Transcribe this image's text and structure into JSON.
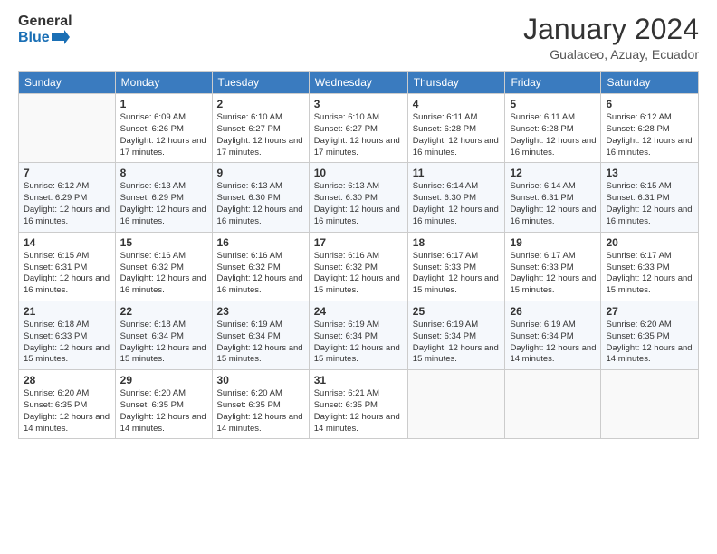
{
  "header": {
    "logo_general": "General",
    "logo_blue": "Blue",
    "month_title": "January 2024",
    "subtitle": "Gualaceo, Azuay, Ecuador"
  },
  "weekdays": [
    "Sunday",
    "Monday",
    "Tuesday",
    "Wednesday",
    "Thursday",
    "Friday",
    "Saturday"
  ],
  "weeks": [
    [
      {
        "day": "",
        "sunrise": "",
        "sunset": "",
        "daylight": ""
      },
      {
        "day": "1",
        "sunrise": "Sunrise: 6:09 AM",
        "sunset": "Sunset: 6:26 PM",
        "daylight": "Daylight: 12 hours and 17 minutes."
      },
      {
        "day": "2",
        "sunrise": "Sunrise: 6:10 AM",
        "sunset": "Sunset: 6:27 PM",
        "daylight": "Daylight: 12 hours and 17 minutes."
      },
      {
        "day": "3",
        "sunrise": "Sunrise: 6:10 AM",
        "sunset": "Sunset: 6:27 PM",
        "daylight": "Daylight: 12 hours and 17 minutes."
      },
      {
        "day": "4",
        "sunrise": "Sunrise: 6:11 AM",
        "sunset": "Sunset: 6:28 PM",
        "daylight": "Daylight: 12 hours and 16 minutes."
      },
      {
        "day": "5",
        "sunrise": "Sunrise: 6:11 AM",
        "sunset": "Sunset: 6:28 PM",
        "daylight": "Daylight: 12 hours and 16 minutes."
      },
      {
        "day": "6",
        "sunrise": "Sunrise: 6:12 AM",
        "sunset": "Sunset: 6:28 PM",
        "daylight": "Daylight: 12 hours and 16 minutes."
      }
    ],
    [
      {
        "day": "7",
        "sunrise": "Sunrise: 6:12 AM",
        "sunset": "Sunset: 6:29 PM",
        "daylight": "Daylight: 12 hours and 16 minutes."
      },
      {
        "day": "8",
        "sunrise": "Sunrise: 6:13 AM",
        "sunset": "Sunset: 6:29 PM",
        "daylight": "Daylight: 12 hours and 16 minutes."
      },
      {
        "day": "9",
        "sunrise": "Sunrise: 6:13 AM",
        "sunset": "Sunset: 6:30 PM",
        "daylight": "Daylight: 12 hours and 16 minutes."
      },
      {
        "day": "10",
        "sunrise": "Sunrise: 6:13 AM",
        "sunset": "Sunset: 6:30 PM",
        "daylight": "Daylight: 12 hours and 16 minutes."
      },
      {
        "day": "11",
        "sunrise": "Sunrise: 6:14 AM",
        "sunset": "Sunset: 6:30 PM",
        "daylight": "Daylight: 12 hours and 16 minutes."
      },
      {
        "day": "12",
        "sunrise": "Sunrise: 6:14 AM",
        "sunset": "Sunset: 6:31 PM",
        "daylight": "Daylight: 12 hours and 16 minutes."
      },
      {
        "day": "13",
        "sunrise": "Sunrise: 6:15 AM",
        "sunset": "Sunset: 6:31 PM",
        "daylight": "Daylight: 12 hours and 16 minutes."
      }
    ],
    [
      {
        "day": "14",
        "sunrise": "Sunrise: 6:15 AM",
        "sunset": "Sunset: 6:31 PM",
        "daylight": "Daylight: 12 hours and 16 minutes."
      },
      {
        "day": "15",
        "sunrise": "Sunrise: 6:16 AM",
        "sunset": "Sunset: 6:32 PM",
        "daylight": "Daylight: 12 hours and 16 minutes."
      },
      {
        "day": "16",
        "sunrise": "Sunrise: 6:16 AM",
        "sunset": "Sunset: 6:32 PM",
        "daylight": "Daylight: 12 hours and 16 minutes."
      },
      {
        "day": "17",
        "sunrise": "Sunrise: 6:16 AM",
        "sunset": "Sunset: 6:32 PM",
        "daylight": "Daylight: 12 hours and 15 minutes."
      },
      {
        "day": "18",
        "sunrise": "Sunrise: 6:17 AM",
        "sunset": "Sunset: 6:33 PM",
        "daylight": "Daylight: 12 hours and 15 minutes."
      },
      {
        "day": "19",
        "sunrise": "Sunrise: 6:17 AM",
        "sunset": "Sunset: 6:33 PM",
        "daylight": "Daylight: 12 hours and 15 minutes."
      },
      {
        "day": "20",
        "sunrise": "Sunrise: 6:17 AM",
        "sunset": "Sunset: 6:33 PM",
        "daylight": "Daylight: 12 hours and 15 minutes."
      }
    ],
    [
      {
        "day": "21",
        "sunrise": "Sunrise: 6:18 AM",
        "sunset": "Sunset: 6:33 PM",
        "daylight": "Daylight: 12 hours and 15 minutes."
      },
      {
        "day": "22",
        "sunrise": "Sunrise: 6:18 AM",
        "sunset": "Sunset: 6:34 PM",
        "daylight": "Daylight: 12 hours and 15 minutes."
      },
      {
        "day": "23",
        "sunrise": "Sunrise: 6:19 AM",
        "sunset": "Sunset: 6:34 PM",
        "daylight": "Daylight: 12 hours and 15 minutes."
      },
      {
        "day": "24",
        "sunrise": "Sunrise: 6:19 AM",
        "sunset": "Sunset: 6:34 PM",
        "daylight": "Daylight: 12 hours and 15 minutes."
      },
      {
        "day": "25",
        "sunrise": "Sunrise: 6:19 AM",
        "sunset": "Sunset: 6:34 PM",
        "daylight": "Daylight: 12 hours and 15 minutes."
      },
      {
        "day": "26",
        "sunrise": "Sunrise: 6:19 AM",
        "sunset": "Sunset: 6:34 PM",
        "daylight": "Daylight: 12 hours and 14 minutes."
      },
      {
        "day": "27",
        "sunrise": "Sunrise: 6:20 AM",
        "sunset": "Sunset: 6:35 PM",
        "daylight": "Daylight: 12 hours and 14 minutes."
      }
    ],
    [
      {
        "day": "28",
        "sunrise": "Sunrise: 6:20 AM",
        "sunset": "Sunset: 6:35 PM",
        "daylight": "Daylight: 12 hours and 14 minutes."
      },
      {
        "day": "29",
        "sunrise": "Sunrise: 6:20 AM",
        "sunset": "Sunset: 6:35 PM",
        "daylight": "Daylight: 12 hours and 14 minutes."
      },
      {
        "day": "30",
        "sunrise": "Sunrise: 6:20 AM",
        "sunset": "Sunset: 6:35 PM",
        "daylight": "Daylight: 12 hours and 14 minutes."
      },
      {
        "day": "31",
        "sunrise": "Sunrise: 6:21 AM",
        "sunset": "Sunset: 6:35 PM",
        "daylight": "Daylight: 12 hours and 14 minutes."
      },
      {
        "day": "",
        "sunrise": "",
        "sunset": "",
        "daylight": ""
      },
      {
        "day": "",
        "sunrise": "",
        "sunset": "",
        "daylight": ""
      },
      {
        "day": "",
        "sunrise": "",
        "sunset": "",
        "daylight": ""
      }
    ]
  ]
}
